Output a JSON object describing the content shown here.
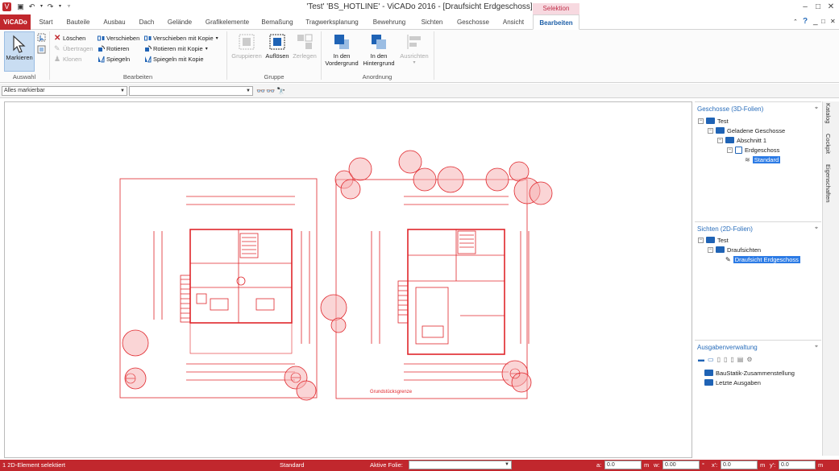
{
  "window": {
    "title": "'Test' 'BS_HOTLINE' - ViCADo 2016 - [Draufsicht Erdgeschoss]",
    "context_tab": "Selektion",
    "controls": [
      "–",
      "□",
      "✕"
    ]
  },
  "ribbon_tabs": [
    {
      "label": "ViCADo"
    },
    {
      "label": "Start"
    },
    {
      "label": "Bauteile"
    },
    {
      "label": "Ausbau"
    },
    {
      "label": "Dach"
    },
    {
      "label": "Gelände"
    },
    {
      "label": "Grafikelemente"
    },
    {
      "label": "Bemaßung"
    },
    {
      "label": "Tragwerksplanung"
    },
    {
      "label": "Bewehrung"
    },
    {
      "label": "Sichten"
    },
    {
      "label": "Geschosse"
    },
    {
      "label": "Ansicht"
    },
    {
      "label": "Bearbeiten"
    }
  ],
  "ribbon_right": {
    "help": "?",
    "minimize": "_",
    "restore": "□",
    "close": "✕"
  },
  "ribbon": {
    "auswahl": {
      "markieren": "Markieren",
      "group": "Auswahl"
    },
    "bearbeiten": {
      "loeschen": "Löschen",
      "uebertragen": "Übertragen",
      "klonen": "Klonen",
      "verschieben": "Verschieben",
      "rotieren": "Rotieren",
      "spiegeln": "Spiegeln",
      "verschieben_kopie": "Verschieben mit Kopie",
      "rotieren_kopie": "Rotieren mit Kopie",
      "spiegeln_kopie": "Spiegeln mit Kopie",
      "group": "Bearbeiten"
    },
    "gruppe": {
      "gruppieren": "Gruppieren",
      "aufloesen": "Auflösen",
      "zerlegen": "Zerlegen",
      "group": "Gruppe"
    },
    "anordnung": {
      "vordergrund_1": "In den",
      "vordergrund_2": "Vordergrund",
      "hintergrund_1": "In den",
      "hintergrund_2": "Hintergrund",
      "ausrichten": "Ausrichten",
      "group": "Anordnung"
    }
  },
  "selection_bar": {
    "filter": "Alles markierbar",
    "second": ""
  },
  "panels": {
    "geschosse": {
      "title": "Geschosse (3D-Folien)",
      "items": [
        "Test",
        "Geladene Geschosse",
        "Abschnitt 1",
        "Erdgeschoss",
        "Standard"
      ]
    },
    "sichten": {
      "title": "Sichten (2D-Folien)",
      "items": [
        "Test",
        "Draufsichten",
        "Draufsicht Erdgeschoss"
      ]
    },
    "ausgaben": {
      "title": "Ausgabenverwaltung",
      "items": [
        "BauStatik-Zusammenstellung",
        "Letzte Ausgaben"
      ]
    }
  },
  "vertical_tabs": [
    "Katalog",
    "Cockpit",
    "Eigenschaften"
  ],
  "drawing": {
    "label": "Grundstücksgrenze"
  },
  "status": {
    "message": "1 2D-Element selektiert",
    "layer": "Standard",
    "active_layer_label": "Aktive Folie:",
    "a_label": "a:",
    "a_value": "0.0",
    "a_unit": "m",
    "w_label": "w:",
    "w_value": "0.00",
    "w_unit": "°",
    "x_label": "x':",
    "x_value": "0.0",
    "x_unit": "m",
    "y_label": "y':",
    "y_value": "0.0",
    "y_unit": "m"
  },
  "colors": {
    "brand": "#c1272d",
    "accent": "#2a6ebb",
    "drawing": "#e0262b"
  }
}
